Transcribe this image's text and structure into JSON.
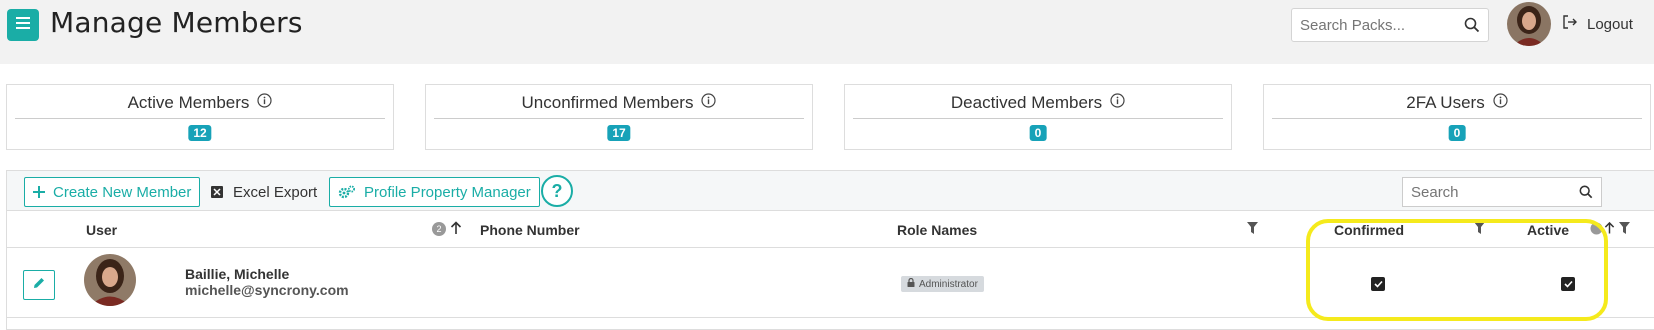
{
  "header": {
    "title": "Manage Members",
    "search_placeholder": "Search Packs...",
    "logout_label": "Logout"
  },
  "stats": [
    {
      "label": "Active Members",
      "value": "12"
    },
    {
      "label": "Unconfirmed Members",
      "value": "17"
    },
    {
      "label": "Deactived Members",
      "value": "0"
    },
    {
      "label": "2FA Users",
      "value": "0"
    }
  ],
  "toolbar": {
    "create_label": "Create New Member",
    "export_label": "Excel Export",
    "profile_label": "Profile Property Manager",
    "help_label": "?",
    "search_placeholder": "Search"
  },
  "columns": {
    "user": "User",
    "sort_order": "2",
    "phone": "Phone Number",
    "roles": "Role Names",
    "confirmed": "Confirmed",
    "active": "Active"
  },
  "rows": [
    {
      "name": "Baillie, Michelle",
      "email": "michelle@syncrony.com",
      "role": "Administrator",
      "confirmed": true,
      "active": true
    }
  ],
  "colors": {
    "accent": "#1aada6",
    "badge": "#17a2b8",
    "highlight": "#f5ea1c"
  }
}
